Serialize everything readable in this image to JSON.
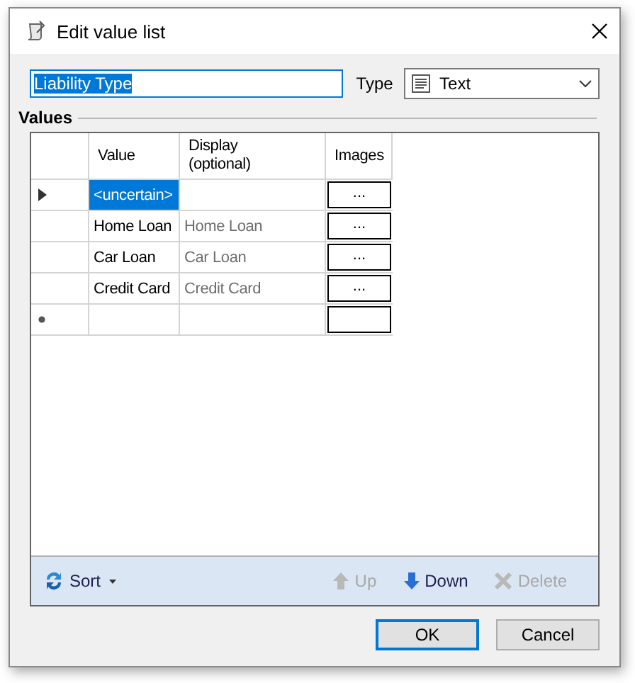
{
  "window": {
    "title": "Edit value list"
  },
  "name_field": {
    "value": "Liability Type",
    "selected": true
  },
  "type_field": {
    "label": "Type",
    "value": "Text"
  },
  "values": {
    "heading": "Values",
    "columns": [
      "Value",
      "Display (optional)",
      "Images"
    ],
    "rows": [
      {
        "kind": "current",
        "value": "<uncertain>",
        "value_selected": true,
        "images": "..."
      },
      {
        "kind": "normal",
        "value": "Home Loan",
        "display": "Home Loan",
        "value_selected": false,
        "images": "..."
      },
      {
        "kind": "normal",
        "value": "Car Loan",
        "display": "Car Loan",
        "value_selected": false,
        "images": "..."
      },
      {
        "kind": "normal",
        "value": "Credit Card",
        "display": "Credit Card",
        "value_selected": false,
        "images": "..."
      },
      {
        "kind": "new",
        "value_selected": false
      }
    ]
  },
  "toolbar": [
    {
      "kind": "sort",
      "label": "Sort",
      "disabled": false
    },
    {
      "kind": "up",
      "label": "Up",
      "disabled": true
    },
    {
      "kind": "down",
      "label": "Down",
      "disabled": false
    },
    {
      "kind": "delete",
      "label": "Delete",
      "disabled": true
    }
  ],
  "buttons": [
    {
      "label": "OK",
      "default": true
    },
    {
      "label": "Cancel",
      "default": false
    }
  ]
}
